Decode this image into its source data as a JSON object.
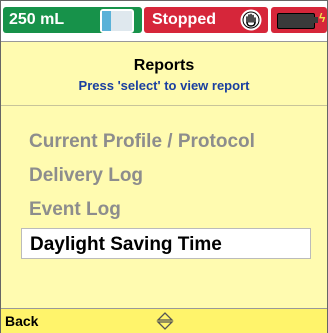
{
  "status": {
    "volume": "250 mL",
    "state": "Stopped",
    "colors": {
      "volume_bg": "#17924a",
      "state_bg": "#d6263a",
      "battery_bg": "#d6263a"
    },
    "icons": {
      "bag": "infusion-bag-icon",
      "hand": "stop-hand-icon",
      "battery": "battery-icon",
      "plug": "power-plug-icon"
    }
  },
  "screen": {
    "title": "Reports",
    "subtitle": "Press 'select' to view report",
    "menu": [
      {
        "label": "Current Profile / Protocol",
        "selected": false
      },
      {
        "label": "Delivery Log",
        "selected": false
      },
      {
        "label": "Event Log",
        "selected": false
      },
      {
        "label": "Daylight Saving Time",
        "selected": true
      }
    ],
    "background": "#fffbb0"
  },
  "footer": {
    "back_label": "Back",
    "nav_icon": "up-down-arrows-icon"
  }
}
